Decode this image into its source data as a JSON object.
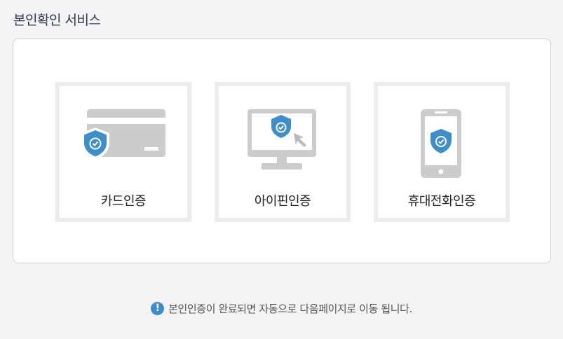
{
  "page": {
    "title": "본인확인 서비스"
  },
  "methods": [
    {
      "label": "카드인증",
      "icon": "card-shield-icon"
    },
    {
      "label": "아이핀인증",
      "icon": "monitor-shield-icon"
    },
    {
      "label": "휴대전화인증",
      "icon": "phone-shield-icon"
    }
  ],
  "notice": {
    "icon": "exclamation-icon",
    "text": "본인인증이 완료되면 자동으로 다음페이지로 이동 됩니다."
  },
  "colors": {
    "accent": "#3d8ec9",
    "icon_gray": "#cccccc",
    "title": "#2b3a55"
  }
}
